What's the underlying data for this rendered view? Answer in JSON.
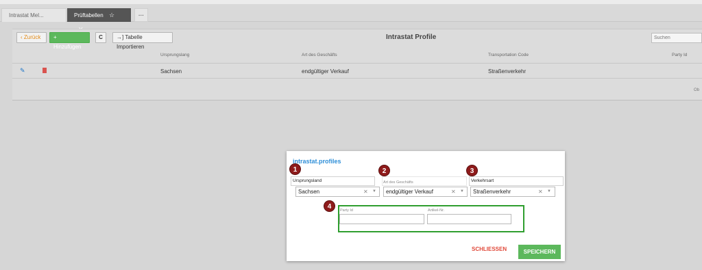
{
  "tabs": {
    "inactive_label": "Intrastat Mel...",
    "active_label": "Prüftabellen",
    "more_label": "···"
  },
  "toolbar": {
    "back_label": "Zurück",
    "add_label": "Hinzufügen",
    "refresh_label": "C",
    "import_label": "Tabelle Importieren",
    "title": "Intrastat Profile",
    "search_placeholder": "Suchen"
  },
  "table": {
    "columns": [
      "Ursprungslang",
      "Art des Geschäfts",
      "Transportation Code",
      "Party Id"
    ],
    "rows": [
      {
        "origin": "Sachsen",
        "business": "endgültiger Verkauf",
        "transport": "Straßenverkehr"
      }
    ],
    "footer": "Ob"
  },
  "modal": {
    "title": "intrastat.profiles",
    "fields": {
      "origin": {
        "label": "Ursprungsland",
        "value": "Sachsen"
      },
      "business": {
        "label": "Art des Geschäfts",
        "value": "endgültiger Verkauf"
      },
      "transport": {
        "label": "Verkehrsart",
        "value": "Straßenverkehr"
      },
      "party": {
        "label": "Party Id",
        "value": ""
      },
      "article": {
        "label": "Artikel-Nr.",
        "value": ""
      }
    },
    "badges": [
      "1",
      "2",
      "3",
      "4"
    ],
    "close_label": "SCHLIESSEN",
    "save_label": "SPEICHERN"
  },
  "colors": {
    "accent": "#2f8fd8",
    "save": "#5cb85c",
    "close": "#e0493a",
    "badge": "#8e1b1b",
    "highlight": "#2e9e2e"
  }
}
